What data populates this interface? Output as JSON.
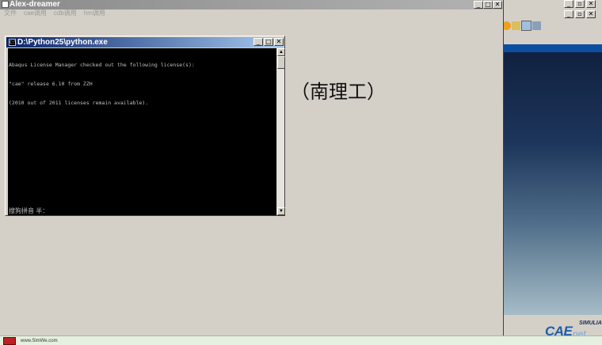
{
  "main_window": {
    "title": "Alex-dreamer",
    "menu": [
      "文件",
      "cae调用",
      "cdb调用",
      "hm调用"
    ],
    "controls": {
      "minimize": "_",
      "maximize": "□",
      "close": "✕"
    },
    "center_text": "（南理工）"
  },
  "console_window": {
    "title": "D:\\Python25\\python.exe",
    "lines": [
      "Abaqus License Manager checked out the following license(s):",
      "\"cae\" release 6.10 from ZZH",
      "(2010 out of 2011 licenses remain available)."
    ],
    "ime_status": "搜狗拼音 半：",
    "controls": {
      "minimize": "_",
      "maximize": "□",
      "close": "✕"
    },
    "scroll_up": "▲",
    "scroll_down": "▼"
  },
  "background_app": {
    "controls": {
      "minimize": "_",
      "maximize": "▫",
      "close": "✕"
    },
    "logo_cae": "CAE",
    "logo_net": "net",
    "logo_brand": "SIMULIA"
  },
  "taskbar": {
    "url_text": "www.SimWe.com"
  },
  "colors": {
    "console_titlebar": "#0a246a",
    "console_bg": "#000000",
    "window_bg": "#d4d0c8",
    "viewport_top": "#11213f"
  }
}
